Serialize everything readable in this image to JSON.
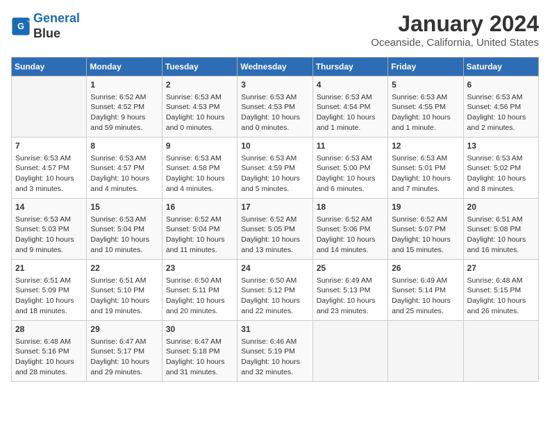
{
  "logo": {
    "line1": "General",
    "line2": "Blue"
  },
  "title": "January 2024",
  "subtitle": "Oceanside, California, United States",
  "headers": [
    "Sunday",
    "Monday",
    "Tuesday",
    "Wednesday",
    "Thursday",
    "Friday",
    "Saturday"
  ],
  "weeks": [
    [
      {
        "day": "",
        "info": ""
      },
      {
        "day": "1",
        "info": "Sunrise: 6:52 AM\nSunset: 4:52 PM\nDaylight: 9 hours\nand 59 minutes."
      },
      {
        "day": "2",
        "info": "Sunrise: 6:53 AM\nSunset: 4:53 PM\nDaylight: 10 hours\nand 0 minutes."
      },
      {
        "day": "3",
        "info": "Sunrise: 6:53 AM\nSunset: 4:53 PM\nDaylight: 10 hours\nand 0 minutes."
      },
      {
        "day": "4",
        "info": "Sunrise: 6:53 AM\nSunset: 4:54 PM\nDaylight: 10 hours\nand 1 minute."
      },
      {
        "day": "5",
        "info": "Sunrise: 6:53 AM\nSunset: 4:55 PM\nDaylight: 10 hours\nand 1 minute."
      },
      {
        "day": "6",
        "info": "Sunrise: 6:53 AM\nSunset: 4:56 PM\nDaylight: 10 hours\nand 2 minutes."
      }
    ],
    [
      {
        "day": "7",
        "info": "Sunrise: 6:53 AM\nSunset: 4:57 PM\nDaylight: 10 hours\nand 3 minutes."
      },
      {
        "day": "8",
        "info": "Sunrise: 6:53 AM\nSunset: 4:57 PM\nDaylight: 10 hours\nand 4 minutes."
      },
      {
        "day": "9",
        "info": "Sunrise: 6:53 AM\nSunset: 4:58 PM\nDaylight: 10 hours\nand 4 minutes."
      },
      {
        "day": "10",
        "info": "Sunrise: 6:53 AM\nSunset: 4:59 PM\nDaylight: 10 hours\nand 5 minutes."
      },
      {
        "day": "11",
        "info": "Sunrise: 6:53 AM\nSunset: 5:00 PM\nDaylight: 10 hours\nand 6 minutes."
      },
      {
        "day": "12",
        "info": "Sunrise: 6:53 AM\nSunset: 5:01 PM\nDaylight: 10 hours\nand 7 minutes."
      },
      {
        "day": "13",
        "info": "Sunrise: 6:53 AM\nSunset: 5:02 PM\nDaylight: 10 hours\nand 8 minutes."
      }
    ],
    [
      {
        "day": "14",
        "info": "Sunrise: 6:53 AM\nSunset: 5:03 PM\nDaylight: 10 hours\nand 9 minutes."
      },
      {
        "day": "15",
        "info": "Sunrise: 6:53 AM\nSunset: 5:04 PM\nDaylight: 10 hours\nand 10 minutes."
      },
      {
        "day": "16",
        "info": "Sunrise: 6:52 AM\nSunset: 5:04 PM\nDaylight: 10 hours\nand 11 minutes."
      },
      {
        "day": "17",
        "info": "Sunrise: 6:52 AM\nSunset: 5:05 PM\nDaylight: 10 hours\nand 13 minutes."
      },
      {
        "day": "18",
        "info": "Sunrise: 6:52 AM\nSunset: 5:06 PM\nDaylight: 10 hours\nand 14 minutes."
      },
      {
        "day": "19",
        "info": "Sunrise: 6:52 AM\nSunset: 5:07 PM\nDaylight: 10 hours\nand 15 minutes."
      },
      {
        "day": "20",
        "info": "Sunrise: 6:51 AM\nSunset: 5:08 PM\nDaylight: 10 hours\nand 16 minutes."
      }
    ],
    [
      {
        "day": "21",
        "info": "Sunrise: 6:51 AM\nSunset: 5:09 PM\nDaylight: 10 hours\nand 18 minutes."
      },
      {
        "day": "22",
        "info": "Sunrise: 6:51 AM\nSunset: 5:10 PM\nDaylight: 10 hours\nand 19 minutes."
      },
      {
        "day": "23",
        "info": "Sunrise: 6:50 AM\nSunset: 5:11 PM\nDaylight: 10 hours\nand 20 minutes."
      },
      {
        "day": "24",
        "info": "Sunrise: 6:50 AM\nSunset: 5:12 PM\nDaylight: 10 hours\nand 22 minutes."
      },
      {
        "day": "25",
        "info": "Sunrise: 6:49 AM\nSunset: 5:13 PM\nDaylight: 10 hours\nand 23 minutes."
      },
      {
        "day": "26",
        "info": "Sunrise: 6:49 AM\nSunset: 5:14 PM\nDaylight: 10 hours\nand 25 minutes."
      },
      {
        "day": "27",
        "info": "Sunrise: 6:48 AM\nSunset: 5:15 PM\nDaylight: 10 hours\nand 26 minutes."
      }
    ],
    [
      {
        "day": "28",
        "info": "Sunrise: 6:48 AM\nSunset: 5:16 PM\nDaylight: 10 hours\nand 28 minutes."
      },
      {
        "day": "29",
        "info": "Sunrise: 6:47 AM\nSunset: 5:17 PM\nDaylight: 10 hours\nand 29 minutes."
      },
      {
        "day": "30",
        "info": "Sunrise: 6:47 AM\nSunset: 5:18 PM\nDaylight: 10 hours\nand 31 minutes."
      },
      {
        "day": "31",
        "info": "Sunrise: 6:46 AM\nSunset: 5:19 PM\nDaylight: 10 hours\nand 32 minutes."
      },
      {
        "day": "",
        "info": ""
      },
      {
        "day": "",
        "info": ""
      },
      {
        "day": "",
        "info": ""
      }
    ]
  ]
}
